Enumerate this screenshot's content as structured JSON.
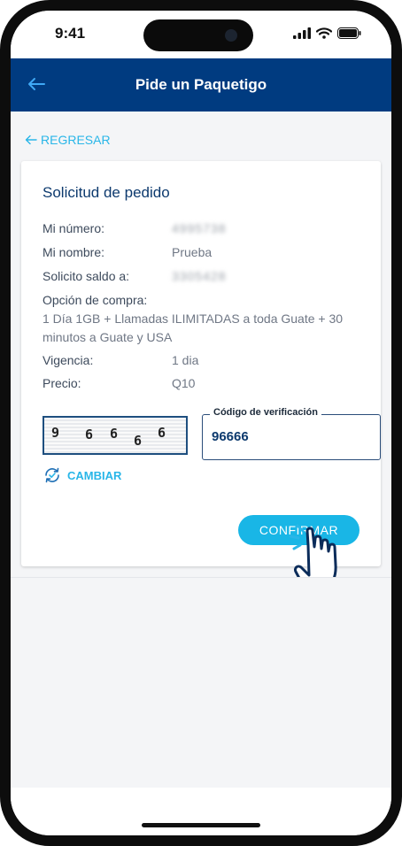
{
  "status_bar": {
    "time": "9:41"
  },
  "app_bar": {
    "title": "Pide un Paquetigo"
  },
  "nav": {
    "back_label": "REGRESAR"
  },
  "card": {
    "title": "Solicitud de pedido",
    "mi_numero_label": "Mi número:",
    "mi_numero_value": "4995738",
    "mi_nombre_label": "Mi nombre:",
    "mi_nombre_value": "Prueba",
    "solicito_label": "Solicito saldo a:",
    "solicito_value": "3305428",
    "opcion_label": "Opción de compra:",
    "opcion_value": "1 Día 1GB + Llamadas ILIMITADAS a toda Guate + 30 minutos a Guate y USA",
    "vigencia_label": "Vigencia:",
    "vigencia_value": "1 dia",
    "precio_label": "Precio:",
    "precio_value": "Q10"
  },
  "captcha": {
    "digits": [
      "9",
      "6",
      "6",
      "6",
      "6"
    ]
  },
  "verification": {
    "label": "Código de verificación",
    "value": "96666"
  },
  "actions": {
    "cambiar_label": "CAMBIAR",
    "confirm_label": "CONFIRMAR"
  },
  "colors": {
    "primary": "#003b80",
    "accent": "#19b6e6",
    "link": "#29b6e8"
  }
}
